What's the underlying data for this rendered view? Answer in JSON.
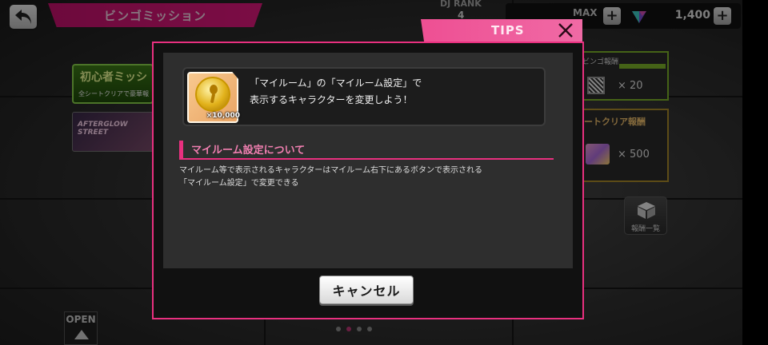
{
  "header": {
    "title": "ビンゴミッション",
    "dj_rank_label": "DJ RANK",
    "dj_rank_value": "4",
    "max_label": "MAX",
    "gem_count": "1,400"
  },
  "background": {
    "banner1_title": "初心者ミッシ",
    "banner1_sub": "全シートクリアで豪華報",
    "banner2_title": "AFTERGLOW STREET",
    "reward1_header": "ビンゴ報酬",
    "reward1_amount": "× 20",
    "reward2_header": "ートクリア報酬",
    "reward2_amount": "× 500",
    "reward_list_label": "報酬一覧",
    "open_label": "OPEN"
  },
  "modal": {
    "tab_label": "TIPS",
    "item_quantity": "×10,000",
    "tip_text": "「マイルーム」の「マイルーム設定」で\n表示するキャラクターを変更しよう！",
    "section_title": "マイルーム設定について",
    "description": "マイルーム等で表示されるキャラクターはマイルーム右下にあるボタンで表示される\n「マイルーム設定」で変更できる",
    "cancel_label": "キャンセル"
  },
  "pager": {
    "count": 4,
    "active_index": 1
  },
  "colors": {
    "accent": "#e8307f",
    "title_bar": "#d4157a"
  }
}
